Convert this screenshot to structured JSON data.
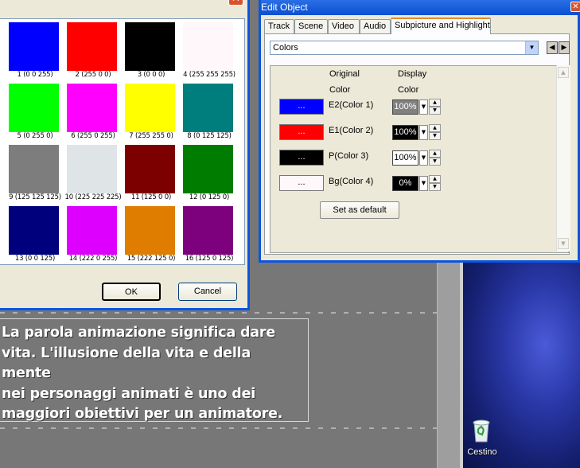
{
  "color_dialog": {
    "close_glyph": "✕",
    "swatches": [
      {
        "label": "1 (0 0 255)",
        "color": "#0000ff"
      },
      {
        "label": "2 (255 0 0)",
        "color": "#ff0000"
      },
      {
        "label": "3 (0 0 0)",
        "color": "#000000"
      },
      {
        "label": "4 (255 255 255)",
        "color": "#fff7f9"
      },
      {
        "label": "5 (0 255 0)",
        "color": "#00ff00"
      },
      {
        "label": "6 (255 0 255)",
        "color": "#ff00ff"
      },
      {
        "label": "7 (255 255 0)",
        "color": "#ffff00"
      },
      {
        "label": "8 (0 125 125)",
        "color": "#007d7d"
      },
      {
        "label": "9 (125 125 125)",
        "color": "#7d7d7d"
      },
      {
        "label": "10 (225 225 225)",
        "color": "#dfe4e7"
      },
      {
        "label": "11 (125 0 0)",
        "color": "#7d0000"
      },
      {
        "label": "12 (0 125 0)",
        "color": "#007d00"
      },
      {
        "label": "13 (0 0 125)",
        "color": "#00007d"
      },
      {
        "label": "14 (222 0 255)",
        "color": "#de00ff"
      },
      {
        "label": "15 (222 125 0)",
        "color": "#de7d00"
      },
      {
        "label": "16 (125 0 125)",
        "color": "#7d007d"
      }
    ],
    "ok_label": "OK",
    "cancel_label": "Cancel"
  },
  "edit_object": {
    "title": "Edit Object",
    "close_glyph": "✕",
    "tabs": [
      {
        "label": "Track",
        "active": false
      },
      {
        "label": "Scene",
        "active": false
      },
      {
        "label": "Video",
        "active": false
      },
      {
        "label": "Audio",
        "active": false
      },
      {
        "label": "Subpicture and Highlight",
        "active": true
      }
    ],
    "category_select": {
      "value": "Colors"
    },
    "prev_glyph": "◀",
    "next_glyph": "▶",
    "header_original": "Original",
    "header_display": "Display",
    "header_color1": "Color",
    "header_color2": "Color",
    "rows": [
      {
        "button_text": "...",
        "button_color": "#0000ff",
        "button_text_color": "#ffffff",
        "label": "E2(Color 1)",
        "display": "100%",
        "display_bg": "#808080",
        "display_fg": "#ffffff"
      },
      {
        "button_text": "...",
        "button_color": "#ff0000",
        "button_text_color": "#ffffff",
        "label": "E1(Color 2)",
        "display": "100%",
        "display_bg": "#000000",
        "display_fg": "#ffffff"
      },
      {
        "button_text": "...",
        "button_color": "#000000",
        "button_text_color": "#ffffff",
        "label": "P(Color 3)",
        "display": "100%",
        "display_bg": "#ffffff",
        "display_fg": "#000000"
      },
      {
        "button_text": "...",
        "button_color": "#fff7f9",
        "button_text_color": "#000000",
        "label": "Bg(Color 4)",
        "display": "0%",
        "display_bg": "#000000",
        "display_fg": "#ffffff"
      }
    ],
    "set_default_label": "Set as default"
  },
  "caption": {
    "text": "La parola animazione significa dare\nvita. L'illusione della vita e della mente\nnei personaggi animati è uno dei\nmaggiori obiettivi per un animatore."
  },
  "desktop": {
    "recycle_bin_label": "Cestino"
  }
}
